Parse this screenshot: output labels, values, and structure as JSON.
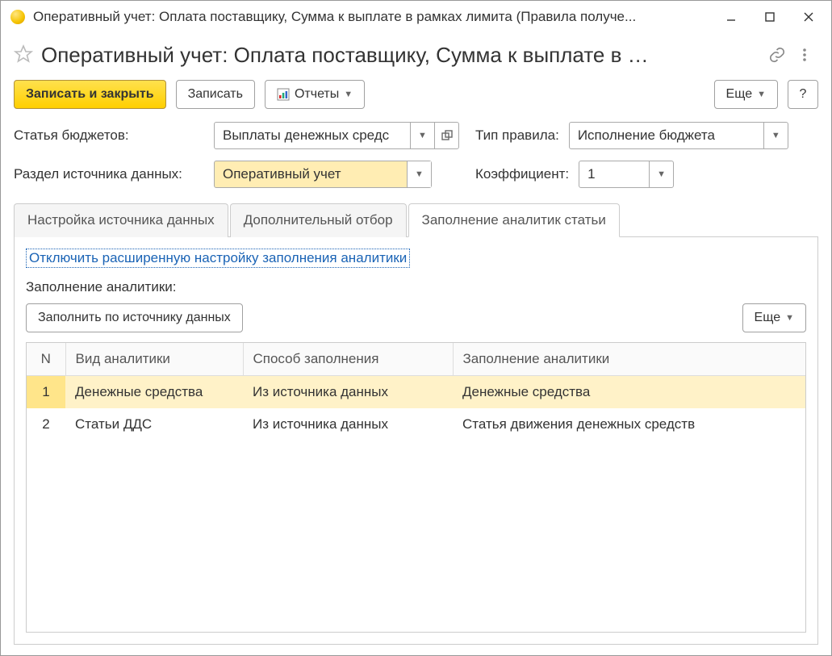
{
  "titlebar": {
    "text": "Оперативный учет: Оплата поставщику, Сумма к выплате в рамках лимита (Правила получе..."
  },
  "header": {
    "title": "Оперативный учет: Оплата поставщику, Сумма к выплате в …"
  },
  "toolbar": {
    "save_close": "Записать и закрыть",
    "save": "Записать",
    "reports": "Отчеты",
    "more": "Еще",
    "help": "?"
  },
  "form": {
    "budget_item_label": "Статья бюджетов:",
    "budget_item_value": "Выплаты денежных средс",
    "rule_type_label": "Тип правила:",
    "rule_type_value": "Исполнение бюджета",
    "source_section_label": "Раздел источника данных:",
    "source_section_value": "Оперативный учет",
    "coefficient_label": "Коэффициент:",
    "coefficient_value": "1"
  },
  "tabs": {
    "items": [
      {
        "label": "Настройка источника данных"
      },
      {
        "label": "Дополнительный отбор"
      },
      {
        "label": "Заполнение аналитик статьи"
      }
    ],
    "active_index": 2
  },
  "tab_content": {
    "disable_link": "Отключить расширенную настройку заполнения аналитики",
    "section_label": "Заполнение аналитики:",
    "fill_button": "Заполнить по источнику данных",
    "more": "Еще"
  },
  "table": {
    "columns": [
      "N",
      "Вид аналитики",
      "Способ заполнения",
      "Заполнение аналитики"
    ],
    "rows": [
      {
        "n": "1",
        "kind": "Денежные средства",
        "method": "Из источника данных",
        "fill": "Денежные средства",
        "selected": true
      },
      {
        "n": "2",
        "kind": "Статьи ДДС",
        "method": "Из источника данных",
        "fill": "Статья движения денежных средств",
        "selected": false
      }
    ]
  }
}
